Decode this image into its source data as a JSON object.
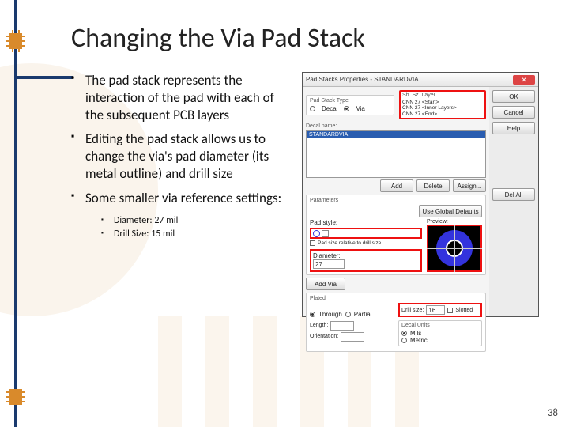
{
  "title": "Changing the Via Pad Stack",
  "bullets": [
    "The pad stack represents the interaction of the pad with each of the subsequent PCB layers",
    "Editing the pad stack allows us to change the via's pad diameter (its metal outline) and drill size",
    "Some smaller via reference settings:"
  ],
  "sub_bullets": [
    "Diameter: 27 mil",
    "Drill Size: 15 mil"
  ],
  "dialog": {
    "title": "Pad Stacks Properties - STANDARDVIA",
    "type_group": "Pad Stack Type",
    "type_decal": "Decal",
    "type_via": "Via",
    "decal_name_label": "Decal name:",
    "decal_name_value": "STANDARDVIA",
    "layers_group": "Sh. Sz. Layer",
    "layer_items": [
      "CNN 27 <Start>",
      "CNN 27 <Inner Layers>",
      "CNN 27 <End>"
    ],
    "add_via_btn": "Add Via",
    "parameters": "Parameters",
    "use_global": "Use Global Defaults",
    "pad_style": "Pad style:",
    "pad_relative": "Pad size relative to drill size",
    "preview_label": "Preview:",
    "diameter_label": "Diameter:",
    "diameter_value": "27",
    "plated_group": "Plated",
    "plated_through": "Through",
    "plated_partial": "Partial",
    "drill_label": "Drill size:",
    "drill_value": "16",
    "slotted": "Slotted",
    "length_label": "Length:",
    "orientation_label": "Orientation:",
    "units_group": "Decal Units",
    "units_mils": "Mils",
    "units_metric": "Metric",
    "add_btn": "Add",
    "delete_btn": "Delete",
    "assign_btn": "Assign...",
    "ok": "OK",
    "cancel": "Cancel",
    "help": "Help",
    "delete_all": "Del All"
  },
  "page_number": "38"
}
